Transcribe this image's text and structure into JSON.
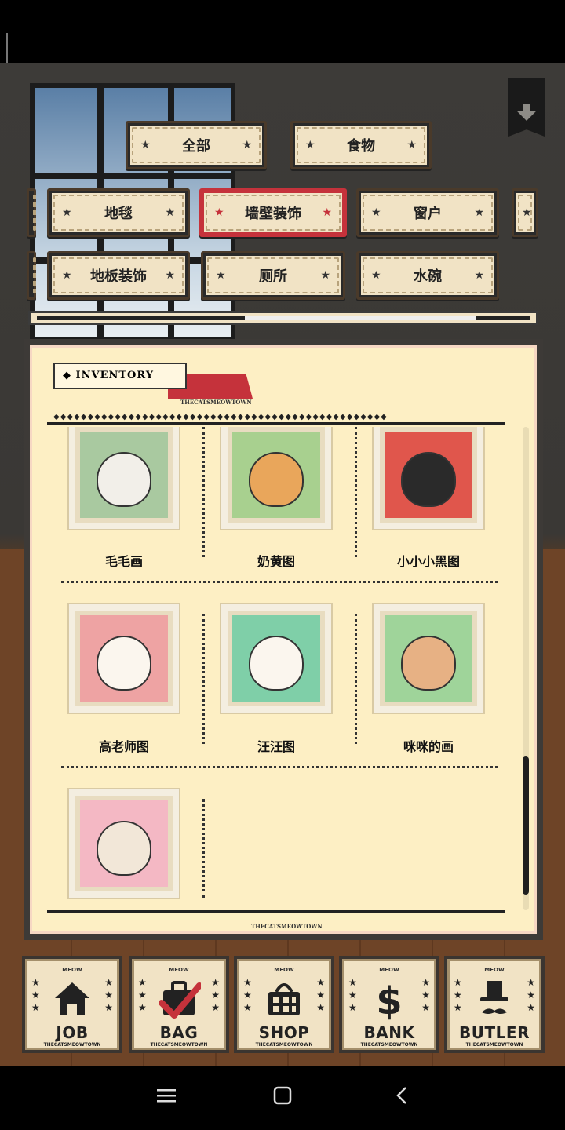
{
  "tabs_row1": [
    {
      "label": "全部"
    },
    {
      "label": "食物"
    }
  ],
  "tabs_row2": [
    {
      "label": "地毯"
    },
    {
      "label": "墙壁装饰",
      "active": true
    },
    {
      "label": "窗户"
    }
  ],
  "tabs_row3": [
    {
      "label": "地板装饰"
    },
    {
      "label": "厕所"
    },
    {
      "label": "水碗"
    }
  ],
  "inventory": {
    "title": "INVENTORY",
    "brand": "THECATSMEOWTOWN",
    "items": [
      {
        "label": "毛毛画",
        "bg": "#a9c9a0",
        "cat": "#f2efe9"
      },
      {
        "label": "奶黄图",
        "bg": "#a8d08f",
        "cat": "#e9a65b"
      },
      {
        "label": "小小小黑图",
        "bg": "#e0564c",
        "cat": "#2a2a2a"
      },
      {
        "label": "高老师图",
        "bg": "#eea3a3",
        "cat": "#fbf6ee"
      },
      {
        "label": "汪汪图",
        "bg": "#7fcfa8",
        "cat": "#fbf6ee"
      },
      {
        "label": "咪咪的画",
        "bg": "#9fd49a",
        "cat": "#e7b184"
      },
      {
        "label": "",
        "bg": "#f4b8c4",
        "cat": "#f2e7d8"
      }
    ]
  },
  "nav": [
    {
      "meow": "MEOW",
      "label": "JOB",
      "brand": "THECATSMEOWTOWN",
      "icon": "house-icon"
    },
    {
      "meow": "MEOW",
      "label": "BAG",
      "brand": "THECATSMEOWTOWN",
      "icon": "bag-icon"
    },
    {
      "meow": "MEOW",
      "label": "SHOP",
      "brand": "THECATSMEOWTOWN",
      "icon": "basket-icon"
    },
    {
      "meow": "MEOW",
      "label": "BANK",
      "brand": "THECATSMEOWTOWN",
      "icon": "dollar-icon"
    },
    {
      "meow": "MEOW",
      "label": "BUTLER",
      "brand": "THECATSMEOWTOWN",
      "icon": "top-hat-icon"
    }
  ],
  "colors": {
    "accent": "#c5323b",
    "paper": "#fdefc4",
    "dark": "#3d3a37"
  }
}
